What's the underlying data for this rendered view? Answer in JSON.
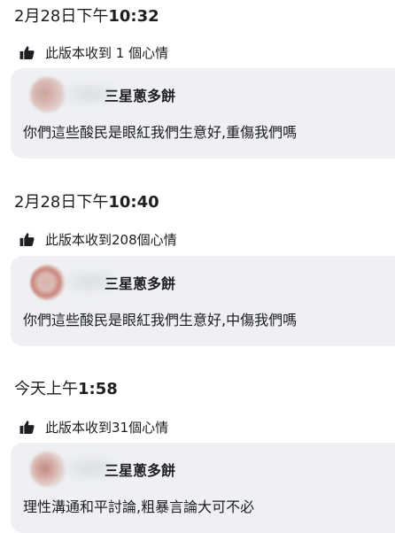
{
  "versions": [
    {
      "date_part": "2月28日下午",
      "time_part": "10:32",
      "reactions": "此版本收到 1 個心情",
      "author": "三星蔥多餅",
      "comment": "你們這些酸民是眼紅我們生意好,重傷我們嗎"
    },
    {
      "date_part": "2月28日下午",
      "time_part": "10:40",
      "reactions": "此版本收到208個心情",
      "author": "三星蔥多餅",
      "comment": "你們這些酸民是眼紅我們生意好,中傷我們嗎"
    },
    {
      "date_part": "今天上午",
      "time_part": "1:58",
      "reactions": "此版本收到31個心情",
      "author": "三星蔥多餅",
      "comment": "理性溝通和平討論,粗暴言論大可不必"
    }
  ],
  "icons": {
    "reaction": "thumbs-up-icon"
  },
  "colors": {
    "bubble_background": "#eef0f3",
    "text": "#1c1e21"
  }
}
